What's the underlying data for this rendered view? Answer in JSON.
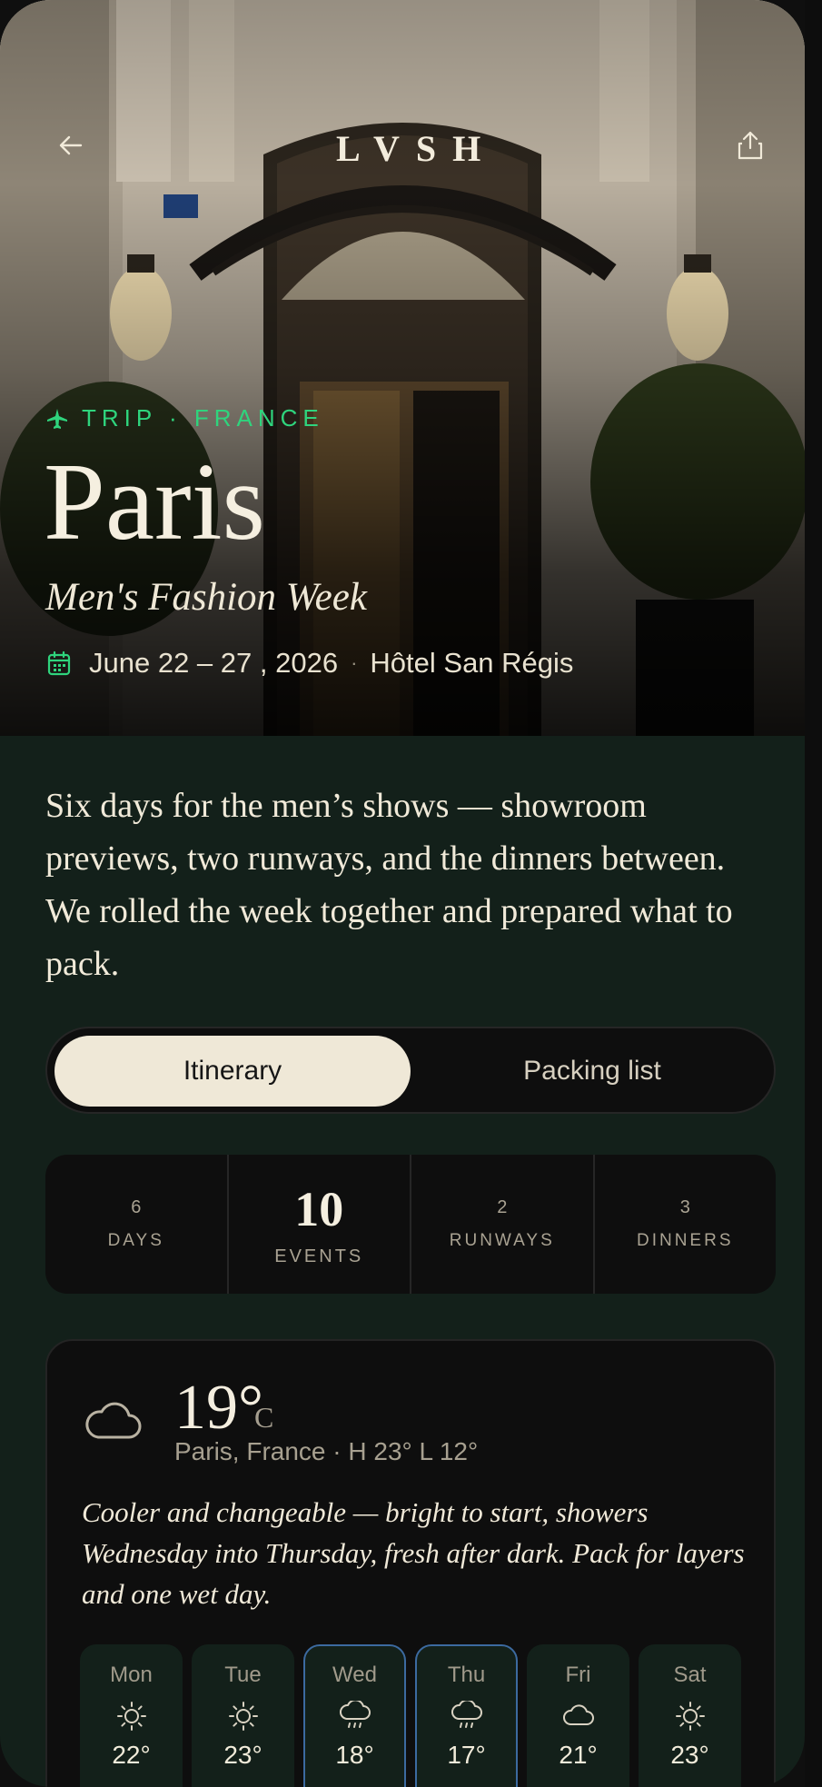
{
  "header": {
    "logo": "LVSH",
    "back_icon": "arrow-left-icon",
    "share_icon": "share-icon"
  },
  "hero": {
    "eyebrow_icon": "plane-icon",
    "eyebrow": "TRIP · FRANCE",
    "title": "Paris",
    "subtitle": "Men's Fashion Week",
    "date_icon": "calendar-icon",
    "dates": "June  22  –  27  , 2026",
    "separator": "·",
    "hotel": "Hôtel San Régis",
    "photo_description": "hotel entrance facade"
  },
  "intro": "Six days for the men’s shows — showroom previews, two runways, and the dinners between. We rolled the week together and prepared what to pack.",
  "tabs": {
    "active": "Itinerary",
    "inactive": "Packing list"
  },
  "stats": [
    {
      "value": "6",
      "label": "DAYS"
    },
    {
      "value": "10",
      "label": "EVENTS"
    },
    {
      "value": "2",
      "label": "RUNWAYS"
    },
    {
      "value": "3",
      "label": "DINNERS"
    }
  ],
  "weather": {
    "icon": "cloud-icon",
    "temp": "19°",
    "unit": "C",
    "location": "Paris, France · H 23° L 12°",
    "description": "Cooler and changeable — bright to start, showers Wednesday into Thursday, fresh after dark. Pack for layers and one wet day.",
    "forecast": [
      {
        "day": "Mon",
        "icon": "sun-icon",
        "temp": "22°"
      },
      {
        "day": "Tue",
        "icon": "sun-icon",
        "temp": "23°"
      },
      {
        "day": "Wed",
        "icon": "rain-cloud-icon",
        "temp": "18°"
      },
      {
        "day": "Thu",
        "icon": "rain-cloud-icon",
        "temp": "17°"
      },
      {
        "day": "Fri",
        "icon": "cloud-icon",
        "temp": "21°"
      },
      {
        "day": "Sat",
        "icon": "sun-icon",
        "temp": "23°"
      }
    ]
  },
  "colors": {
    "accent_green": "#2fd47d",
    "background": "#13201a",
    "card": "#0e0e0e",
    "cream": "#efe8d7",
    "rain_border": "#3c6aa0"
  }
}
